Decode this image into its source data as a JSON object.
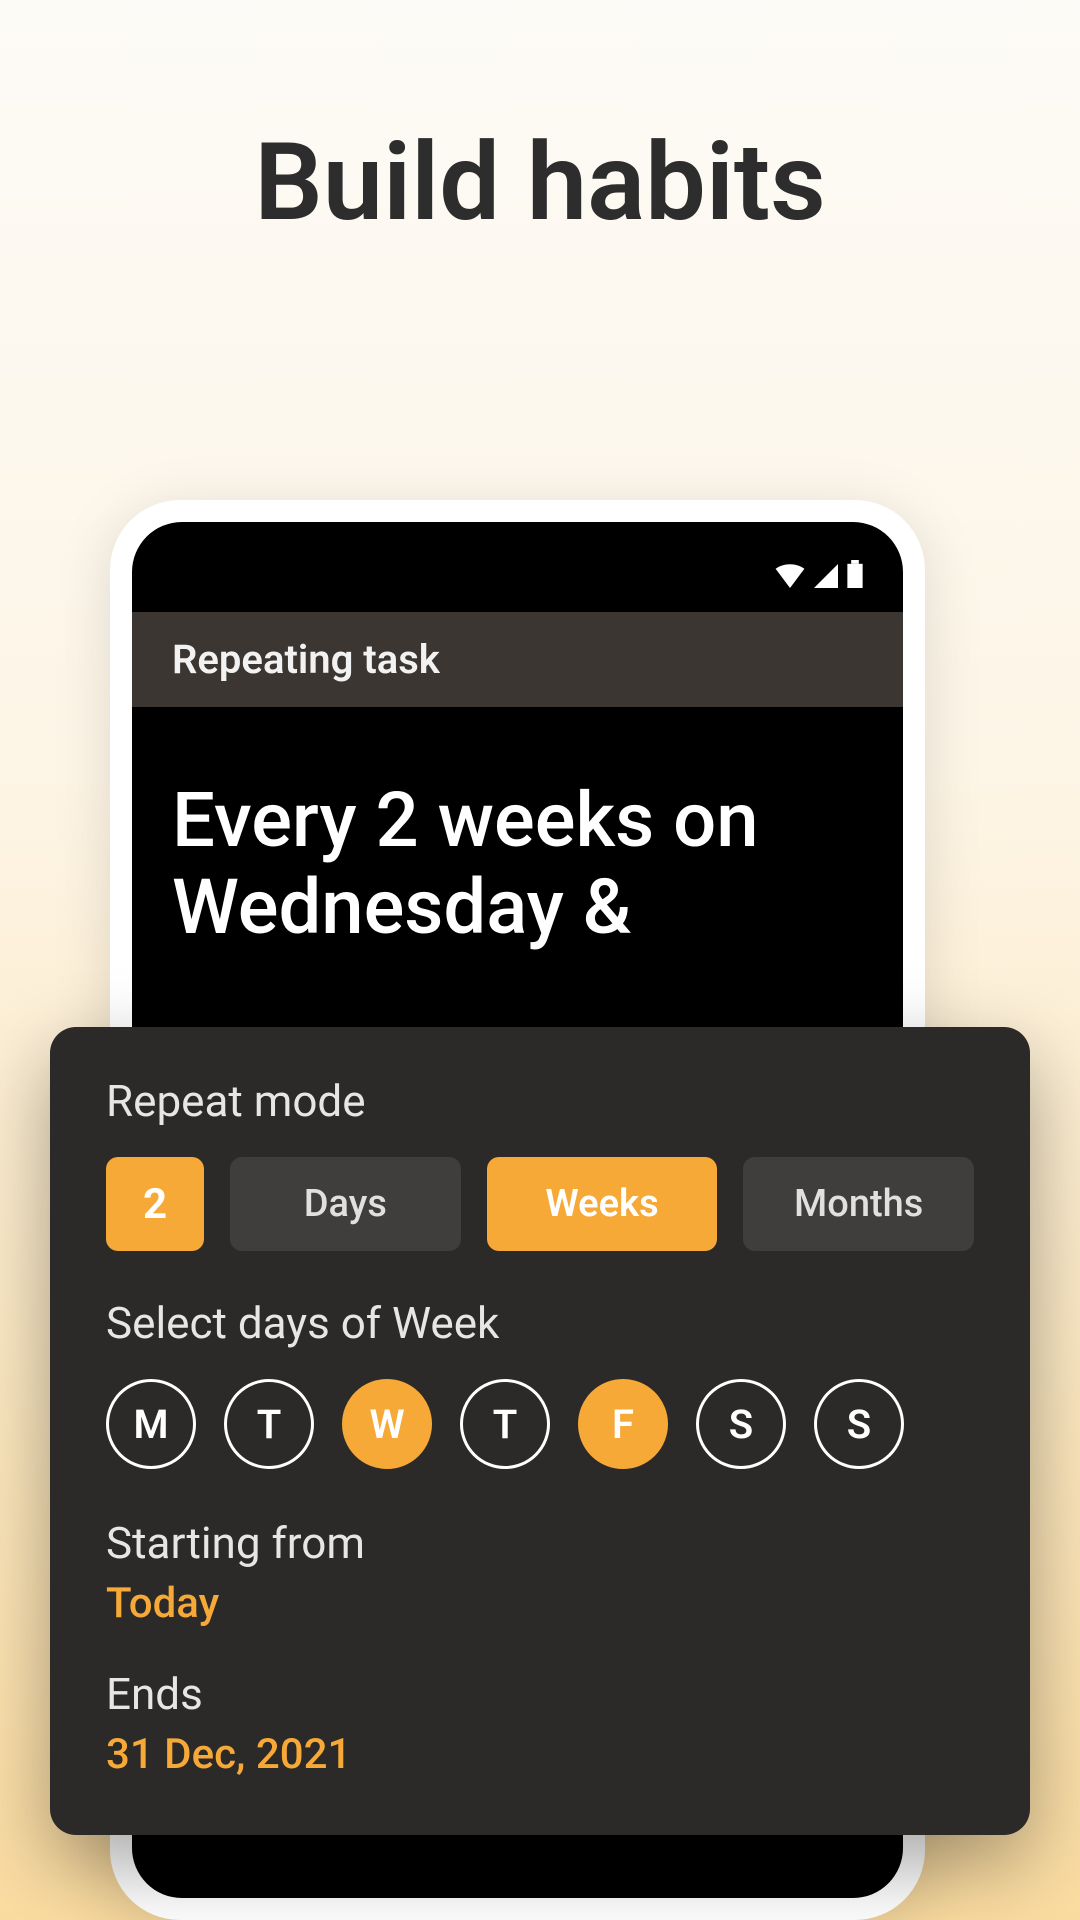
{
  "page": {
    "title": "Build habits"
  },
  "app": {
    "header_title": "Repeating task",
    "task_summary": "Every 2 weeks on Wednesday &"
  },
  "sheet": {
    "repeat_mode_label": "Repeat mode",
    "count": "2",
    "modes": [
      {
        "label": "Days",
        "selected": false
      },
      {
        "label": "Weeks",
        "selected": true
      },
      {
        "label": "Months",
        "selected": false
      }
    ],
    "select_days_label": "Select days of Week",
    "days": [
      {
        "label": "M",
        "selected": false
      },
      {
        "label": "T",
        "selected": false
      },
      {
        "label": "W",
        "selected": true
      },
      {
        "label": "T",
        "selected": false
      },
      {
        "label": "F",
        "selected": true
      },
      {
        "label": "S",
        "selected": false
      },
      {
        "label": "S",
        "selected": false
      }
    ],
    "starting_label": "Starting from",
    "starting_value": "Today",
    "ends_label": "Ends",
    "ends_value": "31 Dec, 2021"
  },
  "colors": {
    "accent": "#f7a938"
  }
}
